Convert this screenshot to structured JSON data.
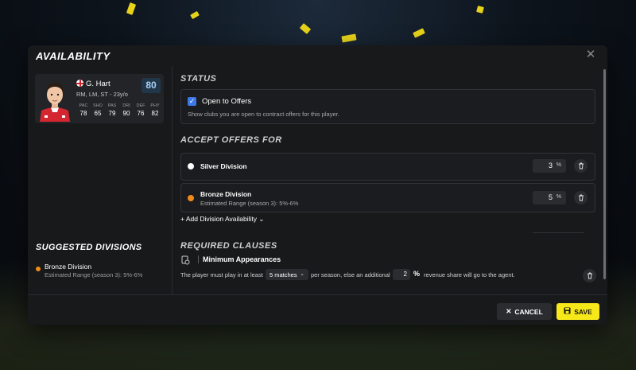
{
  "modal": {
    "title": "AVAILABILITY",
    "close_glyph": "✕"
  },
  "player": {
    "name": "G. Hart",
    "positions": "RM, LM, ST",
    "age": "23y/o",
    "rating": "80",
    "nation_icon": "england-flag-icon",
    "stats": [
      {
        "label": "PAC",
        "value": "78"
      },
      {
        "label": "SHO",
        "value": "65"
      },
      {
        "label": "PAS",
        "value": "79"
      },
      {
        "label": "DRI",
        "value": "90"
      },
      {
        "label": "DEF",
        "value": "76"
      },
      {
        "label": "PHY",
        "value": "82"
      }
    ]
  },
  "suggested": {
    "title": "SUGGESTED DIVISIONS",
    "items": [
      {
        "name": "Bronze Division",
        "range": "Estimated Range (season 3): 5%-6%",
        "dot_color": "#f08a1a"
      }
    ]
  },
  "status": {
    "title": "STATUS",
    "checkbox_label": "Open to Offers",
    "checked": true,
    "description": "Show clubs you are open to contract offers for this player."
  },
  "offers": {
    "title": "ACCEPT OFFERS FOR",
    "rows": [
      {
        "name": "Silver Division",
        "range": "",
        "dot_color": "#ffffff",
        "value": "3",
        "unit": "%"
      },
      {
        "name": "Bronze Division",
        "range": "Estimated Range (season 3): 5%-6%",
        "dot_color": "#f08a1a",
        "value": "5",
        "unit": "%"
      }
    ],
    "add_label": "+ Add Division Availability",
    "add_chevron": "⌄"
  },
  "clauses": {
    "title": "REQUIRED CLAUSES",
    "minimum_appearances": {
      "name": "Minimum Appearances",
      "text_before": "The player must play in at least",
      "matches_value": "5 matches",
      "text_middle": "per season, else an additional",
      "share_value": "2",
      "share_unit": "%",
      "text_after": "revenue share will go to the agent."
    }
  },
  "footer": {
    "cancel_label": "CANCEL",
    "cancel_glyph": "✕",
    "save_label": "SAVE"
  },
  "colors": {
    "accent_yellow": "#f7e81a",
    "checkbox_blue": "#3c78e6",
    "rating_bg": "#22364a",
    "bronze": "#f08a1a"
  }
}
